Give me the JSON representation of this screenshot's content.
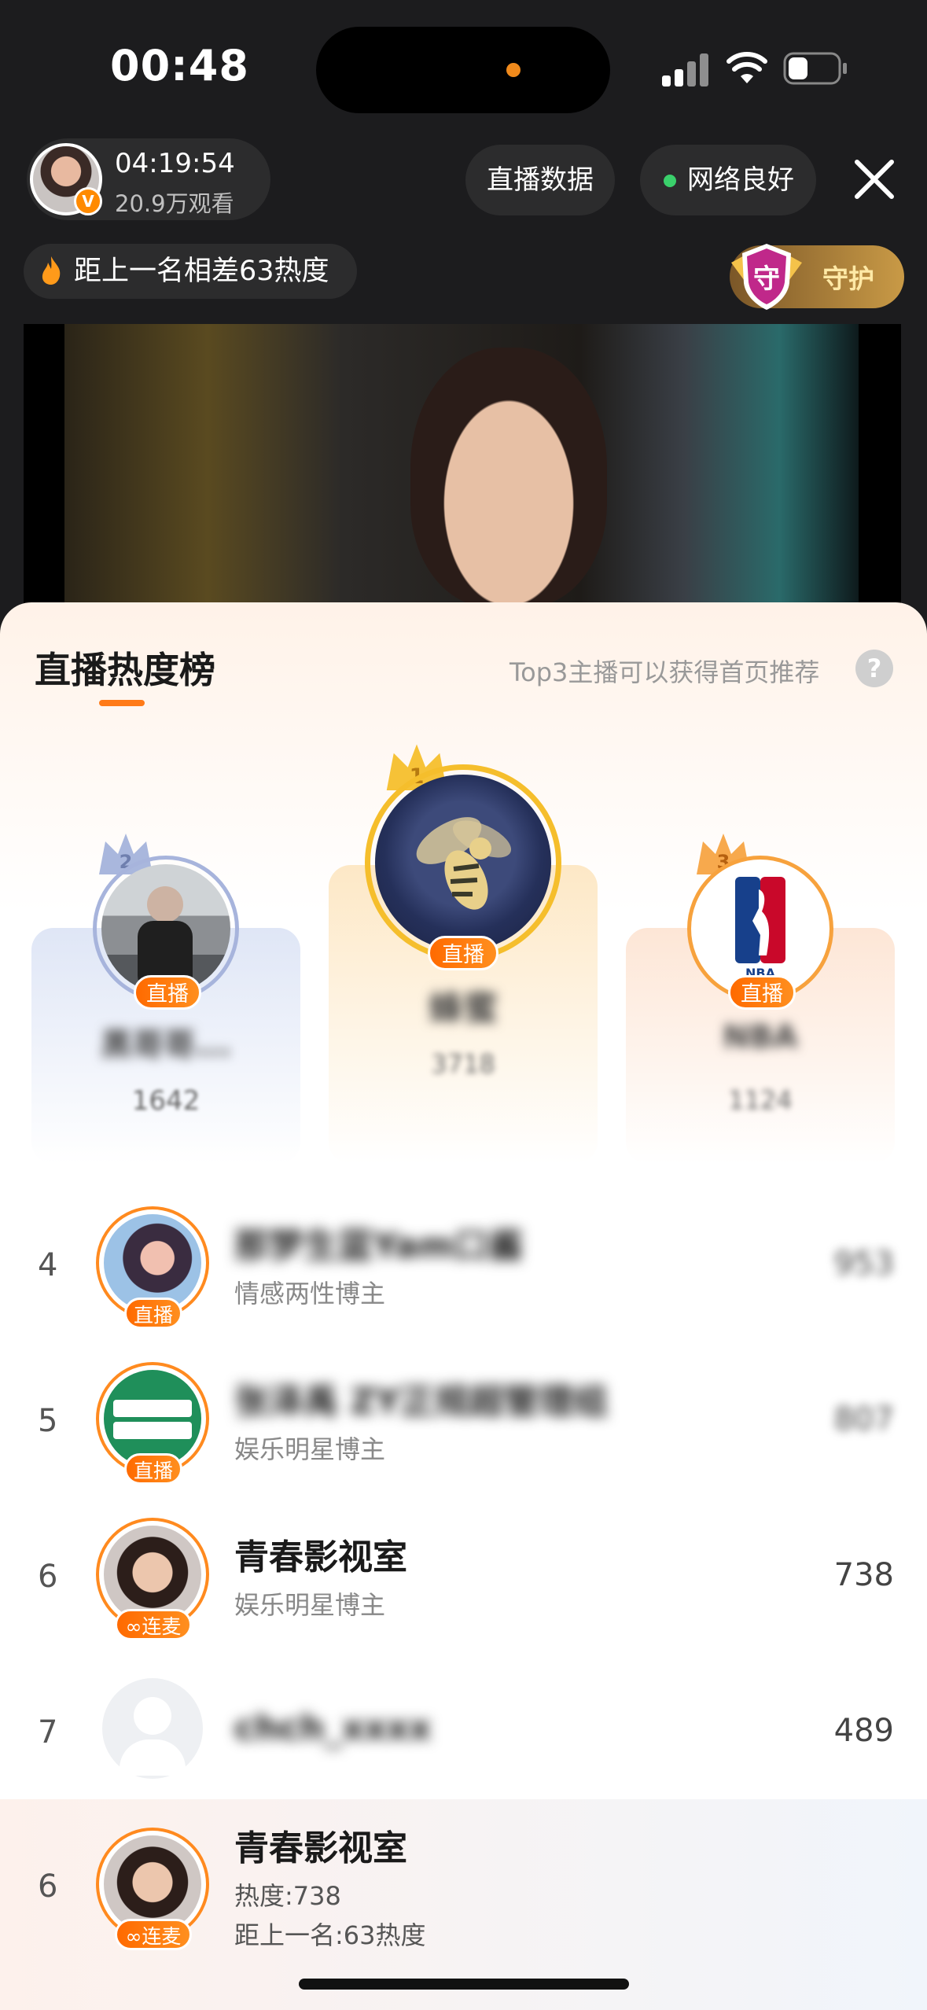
{
  "status_bar": {
    "time": "00:48"
  },
  "anchor": {
    "live_duration": "04:19:54",
    "viewers": "20.9万观看",
    "verified_mark": "V"
  },
  "top_buttons": {
    "live_data": "直播数据",
    "network": "网络良好"
  },
  "heat_gap": {
    "text": "距上一名相差63热度"
  },
  "guard": {
    "label": "守护",
    "shield_char": "守"
  },
  "ranking": {
    "title": "直播热度榜",
    "hint": "Top3主播可以获得首页推荐",
    "help": "?",
    "podium": [
      {
        "rank": "2",
        "name": "黑哥哥...",
        "score": "1642",
        "tag": "直播"
      },
      {
        "rank": "1",
        "name": "蜂蜜",
        "score": "3718",
        "tag": "直播"
      },
      {
        "rank": "3",
        "name": "NBA",
        "score": "1124",
        "tag": "直播"
      }
    ],
    "list": [
      {
        "rank": "4",
        "name": "那梦生蓝Yam口酱",
        "sub": "情感两性博主",
        "score": "953",
        "tag": "直播",
        "blurred": true
      },
      {
        "rank": "5",
        "name": "张泽禹 ZY正规超管理组",
        "sub": "娱乐明星博主",
        "score": "807",
        "tag": "直播",
        "blurred": true
      },
      {
        "rank": "6",
        "name": "青春影视室",
        "sub": "娱乐明星博主",
        "score": "738",
        "tag": "连麦",
        "blurred": false
      },
      {
        "rank": "7",
        "name": "chch_xxxx",
        "sub": "",
        "score": "489",
        "tag": "",
        "blurred": true
      }
    ],
    "mine": {
      "rank": "6",
      "name": "青春影视室",
      "heat": "热度:738",
      "gap": "距上一名:63热度",
      "tag": "连麦"
    }
  },
  "colors": {
    "accent": "#ff7a18",
    "live_tag": "#ff6a00",
    "network_dot": "#3ad06b"
  }
}
